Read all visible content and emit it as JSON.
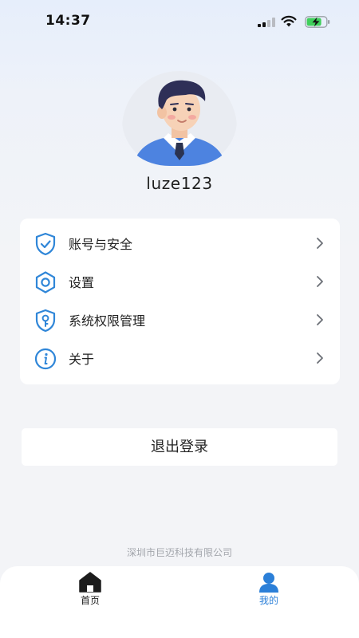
{
  "status_bar": {
    "time": "14:37"
  },
  "profile": {
    "username": "luze123"
  },
  "menu": {
    "items": [
      {
        "label": "账号与安全",
        "icon": "shield-check-icon"
      },
      {
        "label": "设置",
        "icon": "settings-hexagon-icon"
      },
      {
        "label": "系统权限管理",
        "icon": "shield-key-icon"
      },
      {
        "label": "关于",
        "icon": "info-icon"
      }
    ]
  },
  "logout": {
    "label": "退出登录"
  },
  "footer": {
    "company": "深圳市巨迈科技有限公司"
  },
  "tab_bar": {
    "tabs": [
      {
        "label": "首页",
        "icon": "home-icon",
        "active": false
      },
      {
        "label": "我的",
        "icon": "user-icon",
        "active": true
      }
    ]
  },
  "colors": {
    "accent": "#2b7fd8",
    "icon_blue": "#2f86d8",
    "background": "#f3f4f7",
    "card": "#ffffff"
  }
}
